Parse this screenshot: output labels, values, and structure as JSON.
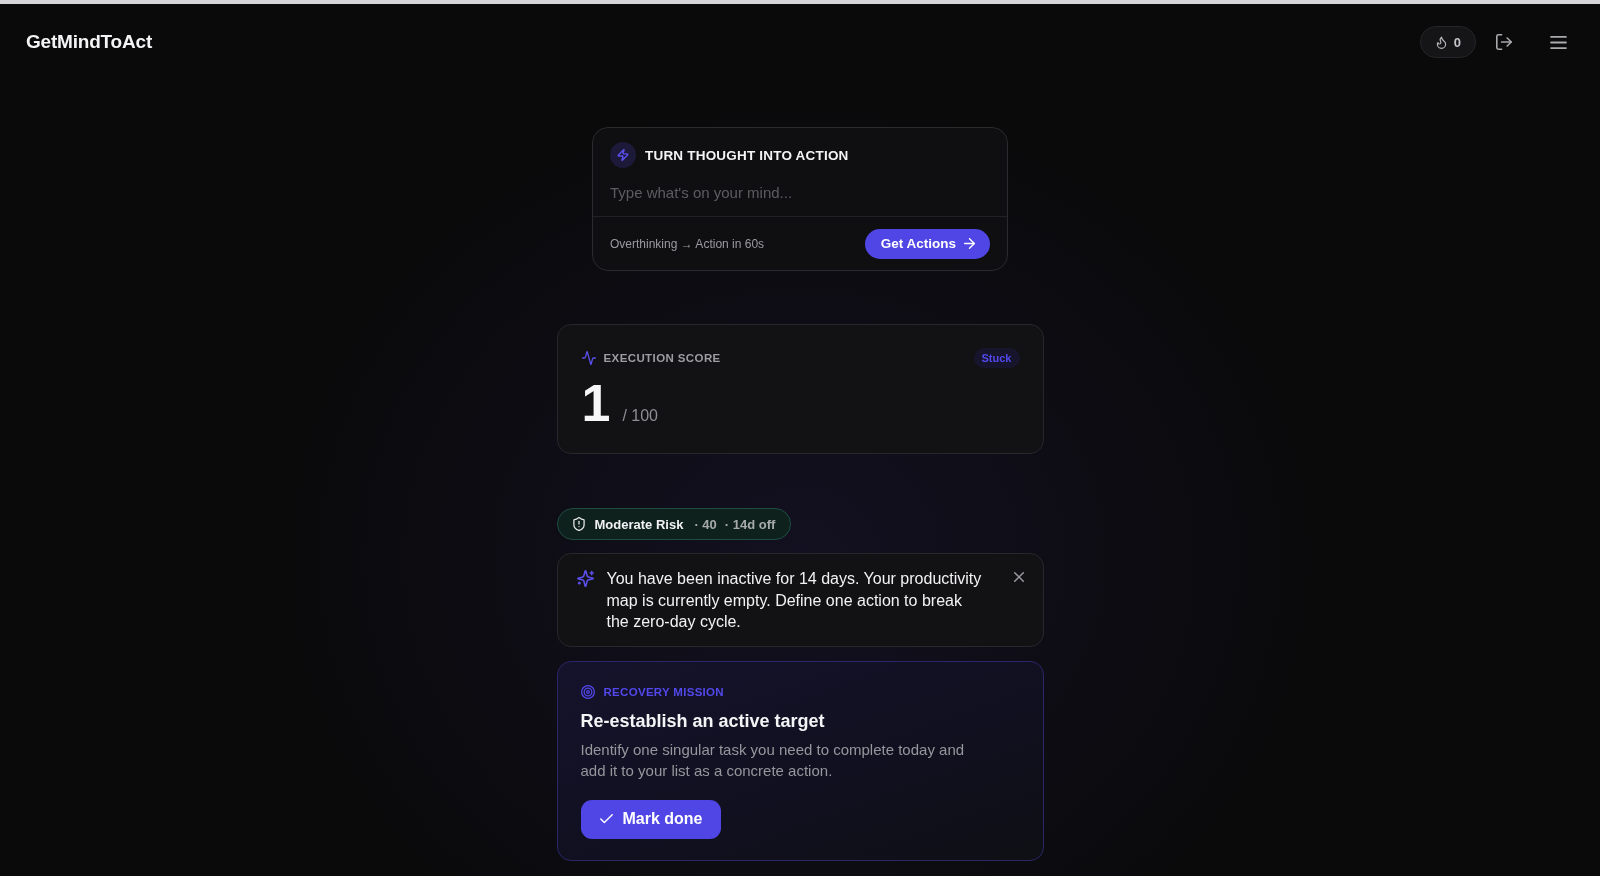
{
  "header": {
    "logo": "GetMindToAct",
    "streak": {
      "count": "0"
    }
  },
  "composer": {
    "title": "TURN THOUGHT INTO ACTION",
    "placeholder": "Type what's on your mind...",
    "tagline": "Overthinking → Action in 60s",
    "button": "Get Actions"
  },
  "execution_score": {
    "label": "EXECUTION SCORE",
    "status": "Stuck",
    "score": "1",
    "max": "/ 100"
  },
  "risk": {
    "label": "Moderate Risk",
    "score": "· 40",
    "days_off": "· 14d off"
  },
  "alert": {
    "message": "You have been inactive for 14 days. Your productivity map is currently empty. Define one action to break the zero-day cycle."
  },
  "mission": {
    "label": "RECOVERY MISSION",
    "title": "Re-establish an active target",
    "description": "Identify one singular task you need to complete today and add it to your list as a concrete action.",
    "button": "Mark done"
  }
}
